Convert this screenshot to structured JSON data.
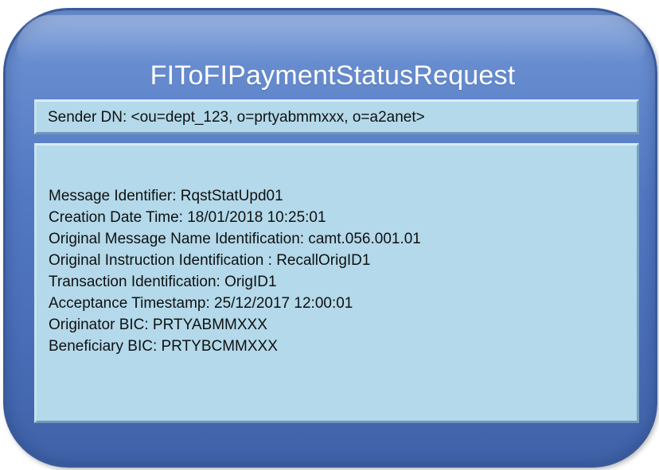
{
  "title": "FIToFIPaymentStatusRequest",
  "sender": {
    "text": "Sender DN: <ou=dept_123, o=prtyabmmxxx, o=a2anet>"
  },
  "fields": [
    "Message Identifier: RqstStatUpd01",
    "Creation Date Time: 18/01/2018 10:25:01",
    "Original Message Name Identification: camt.056.001.01",
    "Original Instruction Identification : RecallOrigID1",
    "Transaction Identification: OrigID1",
    "Acceptance Timestamp: 25/12/2017 12:00:01",
    "Originator BIC: PRTYABMMXXX",
    "Beneficiary BIC: PRTYBCMMXXX"
  ],
  "colors": {
    "outer_fill": "#5379c3",
    "panel_fill": "#b3d9ea",
    "title_text": "#ffffff"
  }
}
